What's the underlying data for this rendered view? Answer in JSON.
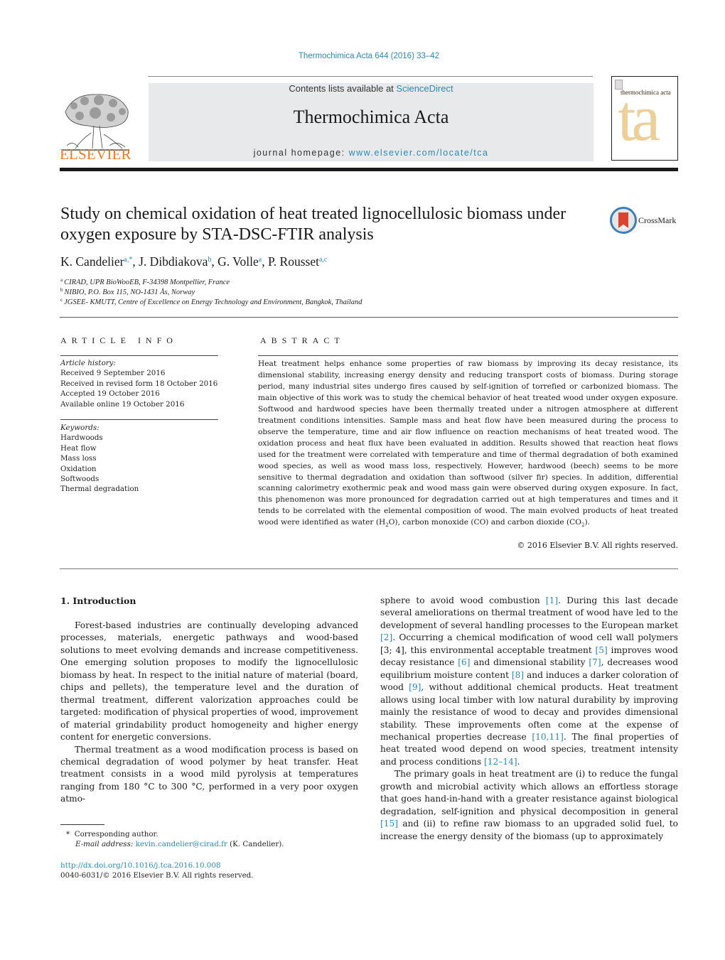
{
  "header": {
    "journal_reference": "Thermochimica Acta 644 (2016) 33–42",
    "publisher_wordmark": "ELSEVIER",
    "contents_prefix": "Contents lists available at ",
    "contents_link": "ScienceDirect",
    "journal_title": "Thermochimica Acta",
    "homepage_prefix": "journal homepage: ",
    "homepage_link": "www.elsevier.com/locate/tca",
    "cover_title": "thermochimica acta",
    "cover_glyph": "ta"
  },
  "colors": {
    "link": "#2a8ab8",
    "elsevier_orange": "#f07b1e",
    "masthead_bg": "#e8e9eb",
    "cover_accent": "#edcf98"
  },
  "article": {
    "title": "Study on chemical oxidation of heat treated lignocellulosic biomass under oxygen exposure by STA-DSC-FTIR analysis",
    "crossmark_label": "CrossMark",
    "authors": [
      {
        "name": "K. Candelier",
        "sup": "a,*"
      },
      {
        "name": "J. Dibdiakova",
        "sup": "b"
      },
      {
        "name": "G. Volle",
        "sup": "a"
      },
      {
        "name": "P. Rousset",
        "sup": "a,c"
      }
    ],
    "author_separator": ", ",
    "affiliations": [
      {
        "sup": "a",
        "text": "CIRAD, UPR BioWooEB, F-34398 Montpellier, France"
      },
      {
        "sup": "b",
        "text": "NIBIO, P.O. Box 115, NO-1431 Ås, Norway"
      },
      {
        "sup": "c",
        "text": "JGSEE- KMUTT, Centre of Excellence on Energy Technology and Environment, Bangkok, Thailand"
      }
    ]
  },
  "article_info": {
    "heading": "ARTICLE INFO",
    "history_label": "Article history:",
    "history": [
      "Received 9 September 2016",
      "Received in revised form 18 October 2016",
      "Accepted 19 October 2016",
      "Available online 19 October 2016"
    ],
    "keywords_label": "Keywords:",
    "keywords": [
      "Hardwoods",
      "Heat flow",
      "Mass loss",
      "Oxidation",
      "Softwoods",
      "Thermal degradation"
    ]
  },
  "abstract": {
    "heading": "ABSTRACT",
    "text_before_h2o": "Heat treatment helps enhance some properties of raw biomass by improving its decay resistance, its dimensional stability, increasing energy density and reducing transport costs of biomass. During storage period, many industrial sites undergo fires caused by self-ignition of torrefied or carbonized biomass. The main objective of this work was to study the chemical behavior of heat treated wood under oxygen exposure. Softwood and hardwood species have been thermally treated under a nitrogen atmosphere at different treatment conditions intensities. Sample mass and heat flow have been measured during the process to observe the temperature, time and air flow influence on reaction mechanisms of heat treated wood. The oxidation process and heat flux have been evaluated in addition. Results showed that reaction heat flows used for the treatment were correlated with temperature and time of thermal degradation of both examined wood species, as well as wood mass loss, respectively. However, hardwood (beech) seems to be more sensitive to thermal degradation and oxidation than softwood (silver fir) species. In addition, differential scanning calorimetry exothermic peak and wood mass gain were observed during oxygen exposure. In fact, this phenomenon was more pronounced for degradation carried out at high temperatures and times and it tends to be correlated with the elemental composition of wood. The main evolved products of heat treated wood were identified as water (H",
    "sub_2a": "2",
    "text_middle": "O), carbon monoxide (CO) and carbon dioxide (CO",
    "sub_2b": "2",
    "text_end": ").",
    "copyright": "© 2016 Elsevier B.V. All rights reserved."
  },
  "introduction": {
    "heading": "1.  Introduction",
    "left_p1": "Forest-based industries are continually developing advanced processes, materials, energetic pathways and wood-based solutions to meet evolving demands and increase competitiveness. One emerging solution proposes to modify the lignocellulosic biomass by heat. In respect to the initial nature of material (board, chips and pellets), the temperature level and the duration of thermal treatment, different valorization approaches could be targeted: modification of physical properties of wood, improvement of material grindability product homogeneity and higher energy content for energetic conversions.",
    "left_p2": "Thermal treatment as a wood modification process is based on chemical degradation of wood polymer by heat transfer. Heat treatment consists in a wood mild pyrolysis at temperatures ranging from 180 °C to 300 °C, performed in a very poor oxygen atmo-",
    "right_p1": [
      {
        "t": "sphere to avoid wood combustion "
      },
      {
        "ref": "[1]"
      },
      {
        "t": ". During this last decade several ameliorations on thermal treatment of wood have led to the development of several handling processes to the European market "
      },
      {
        "ref": "[2]"
      },
      {
        "t": ". Occurring a chemical modification of wood cell wall polymers [3; 4], this environmental acceptable treatment "
      },
      {
        "ref": "[5]"
      },
      {
        "t": " improves wood decay resistance "
      },
      {
        "ref": "[6]"
      },
      {
        "t": " and dimensional stability "
      },
      {
        "ref": "[7]"
      },
      {
        "t": ", decreases wood equilibrium moisture content "
      },
      {
        "ref": "[8]"
      },
      {
        "t": " and induces a darker coloration of wood "
      },
      {
        "ref": "[9]"
      },
      {
        "t": ", without additional chemical products. Heat treatment allows using local timber with low natural durability by improving mainly the resistance of wood to decay and provides dimensional stability. These improvements often come at the expense of mechanical properties decrease "
      },
      {
        "ref": "[10,11]"
      },
      {
        "t": ". The final properties of heat treated wood depend on wood species, treatment intensity and process conditions "
      },
      {
        "ref": "[12–14]"
      },
      {
        "t": "."
      }
    ],
    "right_p2": [
      {
        "t": "The primary goals in heat treatment are (i) to reduce the fungal growth and microbial activity which allows an effortless storage that goes hand-in-hand with a greater resistance against biological degradation, self-ignition and physical decomposition in general "
      },
      {
        "ref": "[15]"
      },
      {
        "t": " and (ii) to refine raw biomass to an upgraded solid fuel, to increase the energy density of the biomass (up to approximately"
      }
    ]
  },
  "footnotes": {
    "corresponding_mark": "*",
    "corresponding_text": "Corresponding author.",
    "email_label": "E-mail address: ",
    "email": "kevin.candelier@cirad.fr",
    "email_suffix": " (K. Candelier).",
    "doi": "http://dx.doi.org/10.1016/j.tca.2016.10.008",
    "issn_line": "0040-6031/© 2016 Elsevier B.V. All rights reserved."
  }
}
